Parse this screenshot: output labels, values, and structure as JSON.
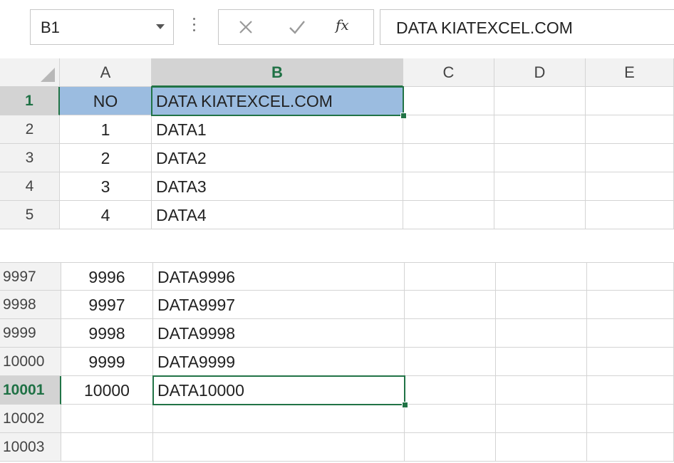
{
  "namebox": {
    "value": "B1"
  },
  "formula_bar": {
    "cancel_icon": "x-icon",
    "enter_icon": "checkmark-icon",
    "fx_label": "fx",
    "content": "DATA KIATEXCEL.COM"
  },
  "columns": [
    "A",
    "B",
    "C",
    "D",
    "E"
  ],
  "selected_column": "B",
  "top_rows": [
    {
      "num": "1",
      "a": "NO",
      "b": "DATA KIATEXCEL.COM"
    },
    {
      "num": "2",
      "a": "1",
      "b": "DATA1"
    },
    {
      "num": "3",
      "a": "2",
      "b": "DATA2"
    },
    {
      "num": "4",
      "a": "3",
      "b": "DATA3"
    },
    {
      "num": "5",
      "a": "4",
      "b": "DATA4"
    }
  ],
  "bottom_rows": [
    {
      "num": "9997",
      "a": "9996",
      "b": "DATA9996"
    },
    {
      "num": "9998",
      "a": "9997",
      "b": "DATA9997"
    },
    {
      "num": "9999",
      "a": "9998",
      "b": "DATA9998"
    },
    {
      "num": "10000",
      "a": "9999",
      "b": "DATA9999"
    },
    {
      "num": "10001",
      "a": "10000",
      "b": "DATA10000"
    },
    {
      "num": "10002",
      "a": "",
      "b": ""
    },
    {
      "num": "10003",
      "a": "",
      "b": ""
    }
  ],
  "colors": {
    "selection_border": "#217346",
    "highlight_fill": "#9bbce0",
    "header_bg": "#f2f2f2"
  }
}
